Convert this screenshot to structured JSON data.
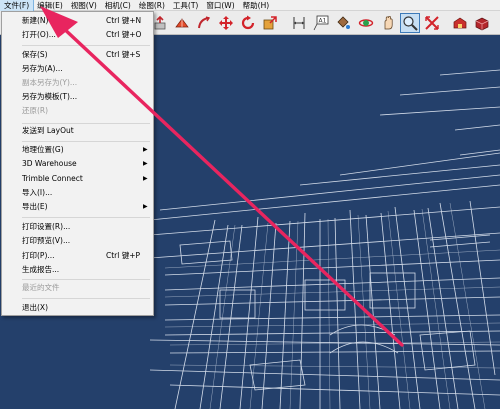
{
  "menubar": {
    "items": [
      {
        "label": "文件(F)"
      },
      {
        "label": "编辑(E)"
      },
      {
        "label": "视图(V)"
      },
      {
        "label": "相机(C)"
      },
      {
        "label": "绘图(R)"
      },
      {
        "label": "工具(T)"
      },
      {
        "label": "窗口(W)"
      },
      {
        "label": "帮助(H)"
      }
    ]
  },
  "toolbar": {
    "icons": [
      "pushpull-icon",
      "followme-icon",
      "move-icon",
      "rotate-icon",
      "scale-icon",
      "dimension-icon",
      "text-icon",
      "paint-bucket-icon",
      "orbit-icon",
      "pan-icon",
      "zoom-icon",
      "zoom-extents-icon",
      "3d-warehouse-icon",
      "extension-warehouse-icon",
      "share-model-icon"
    ]
  },
  "file_menu": {
    "items": [
      {
        "label": "新建(N)",
        "shortcut": "Ctrl 键+N"
      },
      {
        "label": "打开(O)...",
        "shortcut": "Ctrl 键+O"
      },
      {
        "label": "保存(S)",
        "shortcut": "Ctrl 键+S"
      },
      {
        "label": "另存为(A)..."
      },
      {
        "label": "副本另存为(Y)...",
        "disabled": true
      },
      {
        "label": "另存为模板(T)..."
      },
      {
        "label": "还原(R)",
        "disabled": true
      },
      {
        "label": "发送到 LayOut"
      },
      {
        "label": "地理位置(G)",
        "submenu": true
      },
      {
        "label": "3D Warehouse",
        "submenu": true
      },
      {
        "label": "Trimble Connect",
        "submenu": true
      },
      {
        "label": "导入(I)..."
      },
      {
        "label": "导出(E)",
        "submenu": true
      },
      {
        "label": "打印设置(R)..."
      },
      {
        "label": "打印预览(V)..."
      },
      {
        "label": "打印(P)...",
        "shortcut": "Ctrl 键+P"
      },
      {
        "label": "生成报告..."
      },
      {
        "label": "最近的文件",
        "disabled": true
      },
      {
        "label": "退出(X)"
      }
    ],
    "submenu_glyph": "▶"
  },
  "colors": {
    "viewport_bg": "#24406b",
    "line_color": "#e8eef8",
    "annotation_arrow": "#e8255f"
  }
}
